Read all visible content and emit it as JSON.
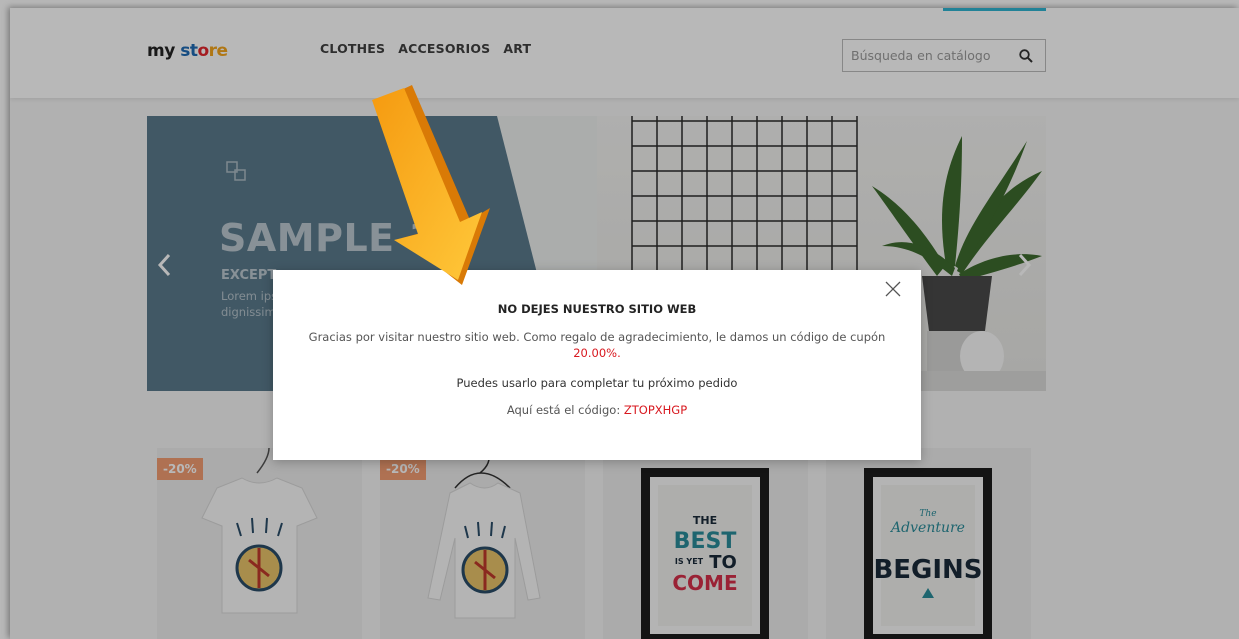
{
  "header": {
    "logo": {
      "part1": "my",
      "part2": " st",
      "part3": "o",
      "part4": "re"
    },
    "nav": [
      {
        "label": "CLOTHES"
      },
      {
        "label": "ACCESORIOS"
      },
      {
        "label": "ART"
      }
    ],
    "search": {
      "placeholder": "Búsqueda en catálogo",
      "icon": "search-icon"
    }
  },
  "slider": {
    "title": "SAMPLE 1",
    "subtitle": "EXCEPT",
    "text": "Lorem ips adipiscin dignissim egestas s",
    "prev_icon": "chevron-left-icon",
    "next_icon": "chevron-right-icon"
  },
  "products": [
    {
      "badge": "-20%",
      "kind": "tshirt"
    },
    {
      "badge": "-20%",
      "kind": "longsleeve"
    },
    {
      "badge": "",
      "kind": "poster-best"
    },
    {
      "badge": "",
      "kind": "poster-adventure"
    }
  ],
  "popup": {
    "title": "NO DEJES NUESTRO SITIO WEB",
    "message": "Gracias por visitar nuestro sitio web. Como regalo de agradecimiento, le damos un código de cupón",
    "percent": "20.00%.",
    "use_text": "Puedes usarlo para completar tu próximo pedido",
    "code_label": "Aquí está el código: ",
    "code": "ZTOPXHGP",
    "close_icon": "close-icon"
  },
  "posters": {
    "best": {
      "line1": "THE",
      "line2": "BEST",
      "line3": "IS YET",
      "line4": "TO",
      "line5": "COME"
    },
    "adventure": {
      "line1": "The",
      "line2": "Adventure",
      "line3": "BEGINS"
    }
  },
  "colors": {
    "accent": "#2fb5d2",
    "badge": "#f39d72",
    "coupon_red": "#d8181f",
    "arrow_orange": "#f7a21b"
  }
}
